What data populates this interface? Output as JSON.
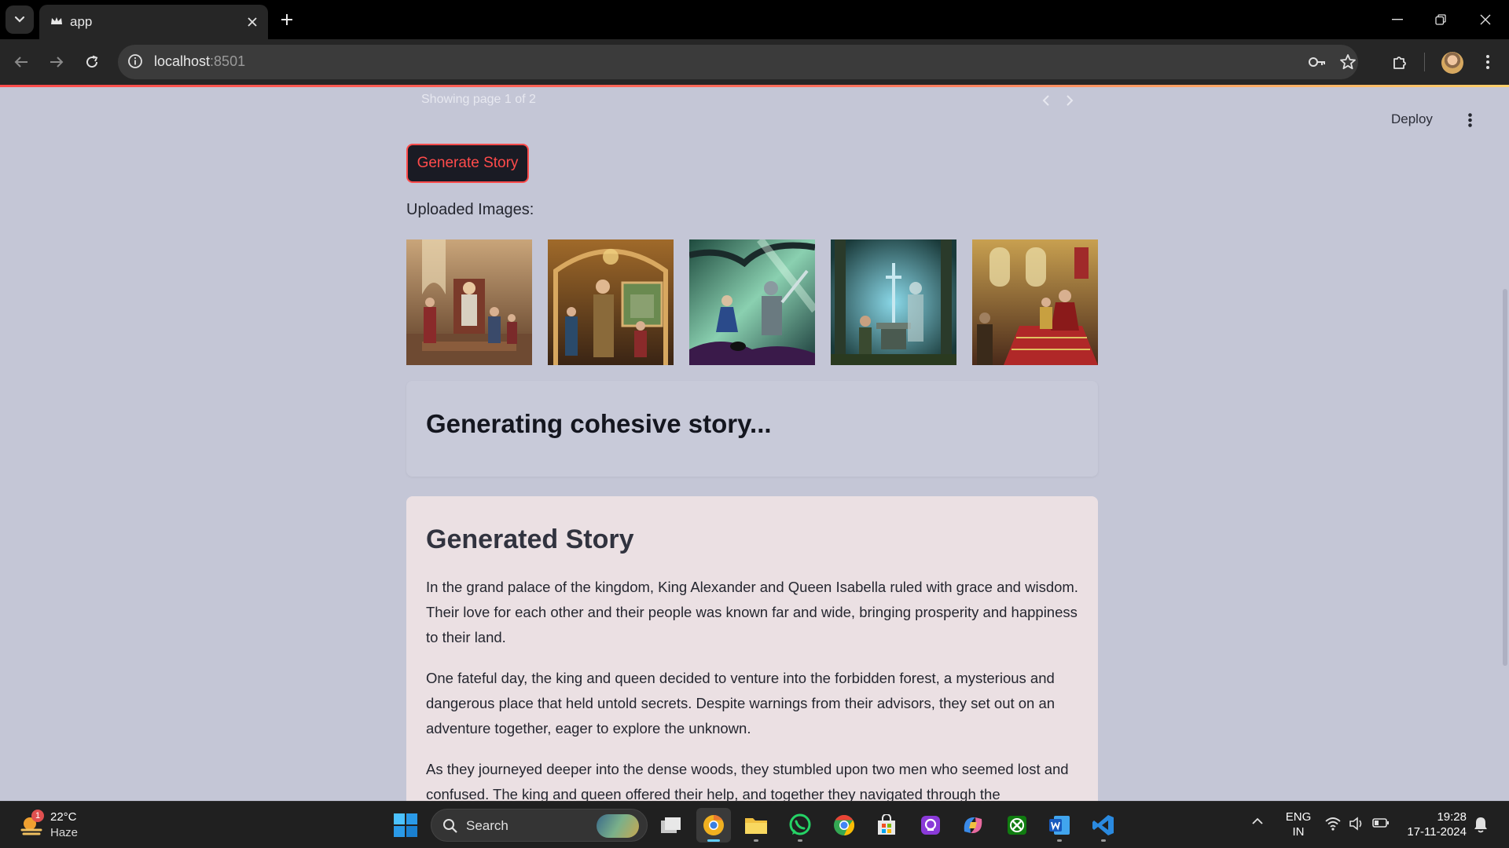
{
  "browser": {
    "tab_title": "app",
    "url_host": "localhost",
    "url_port": ":8501"
  },
  "page": {
    "pagination_text": "Showing page 1 of 2",
    "deploy_label": "Deploy",
    "generate_button_label": "Generate Story",
    "uploaded_images_label": "Uploaded Images:",
    "status_heading": "Generating cohesive story...",
    "story": {
      "title": "Generated Story",
      "paragraphs": [
        "In the grand palace of the kingdom, King Alexander and Queen Isabella ruled with grace and wisdom. Their love for each other and their people was known far and wide, bringing prosperity and happiness to their land.",
        "One fateful day, the king and queen decided to venture into the forbidden forest, a mysterious and dangerous place that held untold secrets. Despite warnings from their advisors, they set out on an adventure together, eager to explore the unknown.",
        "As they journeyed deeper into the dense woods, they stumbled upon two men who seemed lost and confused. The king and queen offered their help, and together they navigated through the"
      ]
    },
    "images": [
      {
        "scene": "throne-room-scene"
      },
      {
        "scene": "castle-hall-scene"
      },
      {
        "scene": "forest-battle-scene"
      },
      {
        "scene": "sword-in-stone-scene"
      },
      {
        "scene": "coronation-scene"
      }
    ]
  },
  "taskbar": {
    "weather_temp": "22°C",
    "weather_desc": "Haze",
    "weather_badge": "1",
    "search_label": "Search",
    "lang_line1": "ENG",
    "lang_line2": "IN",
    "time": "19:28",
    "date": "17-11-2024",
    "apps": [
      "task-view",
      "chrome-canary",
      "file-explorer",
      "whatsapp",
      "chrome",
      "microsoft-store",
      "media-app",
      "copilot",
      "xbox",
      "word",
      "vscode"
    ]
  },
  "colors": {
    "accent": "#ff4b4b",
    "page_background": "#c4c6d6",
    "story_card_background": "#ebe0e3",
    "browser_chrome": "#262626",
    "taskbar": "#202020"
  }
}
